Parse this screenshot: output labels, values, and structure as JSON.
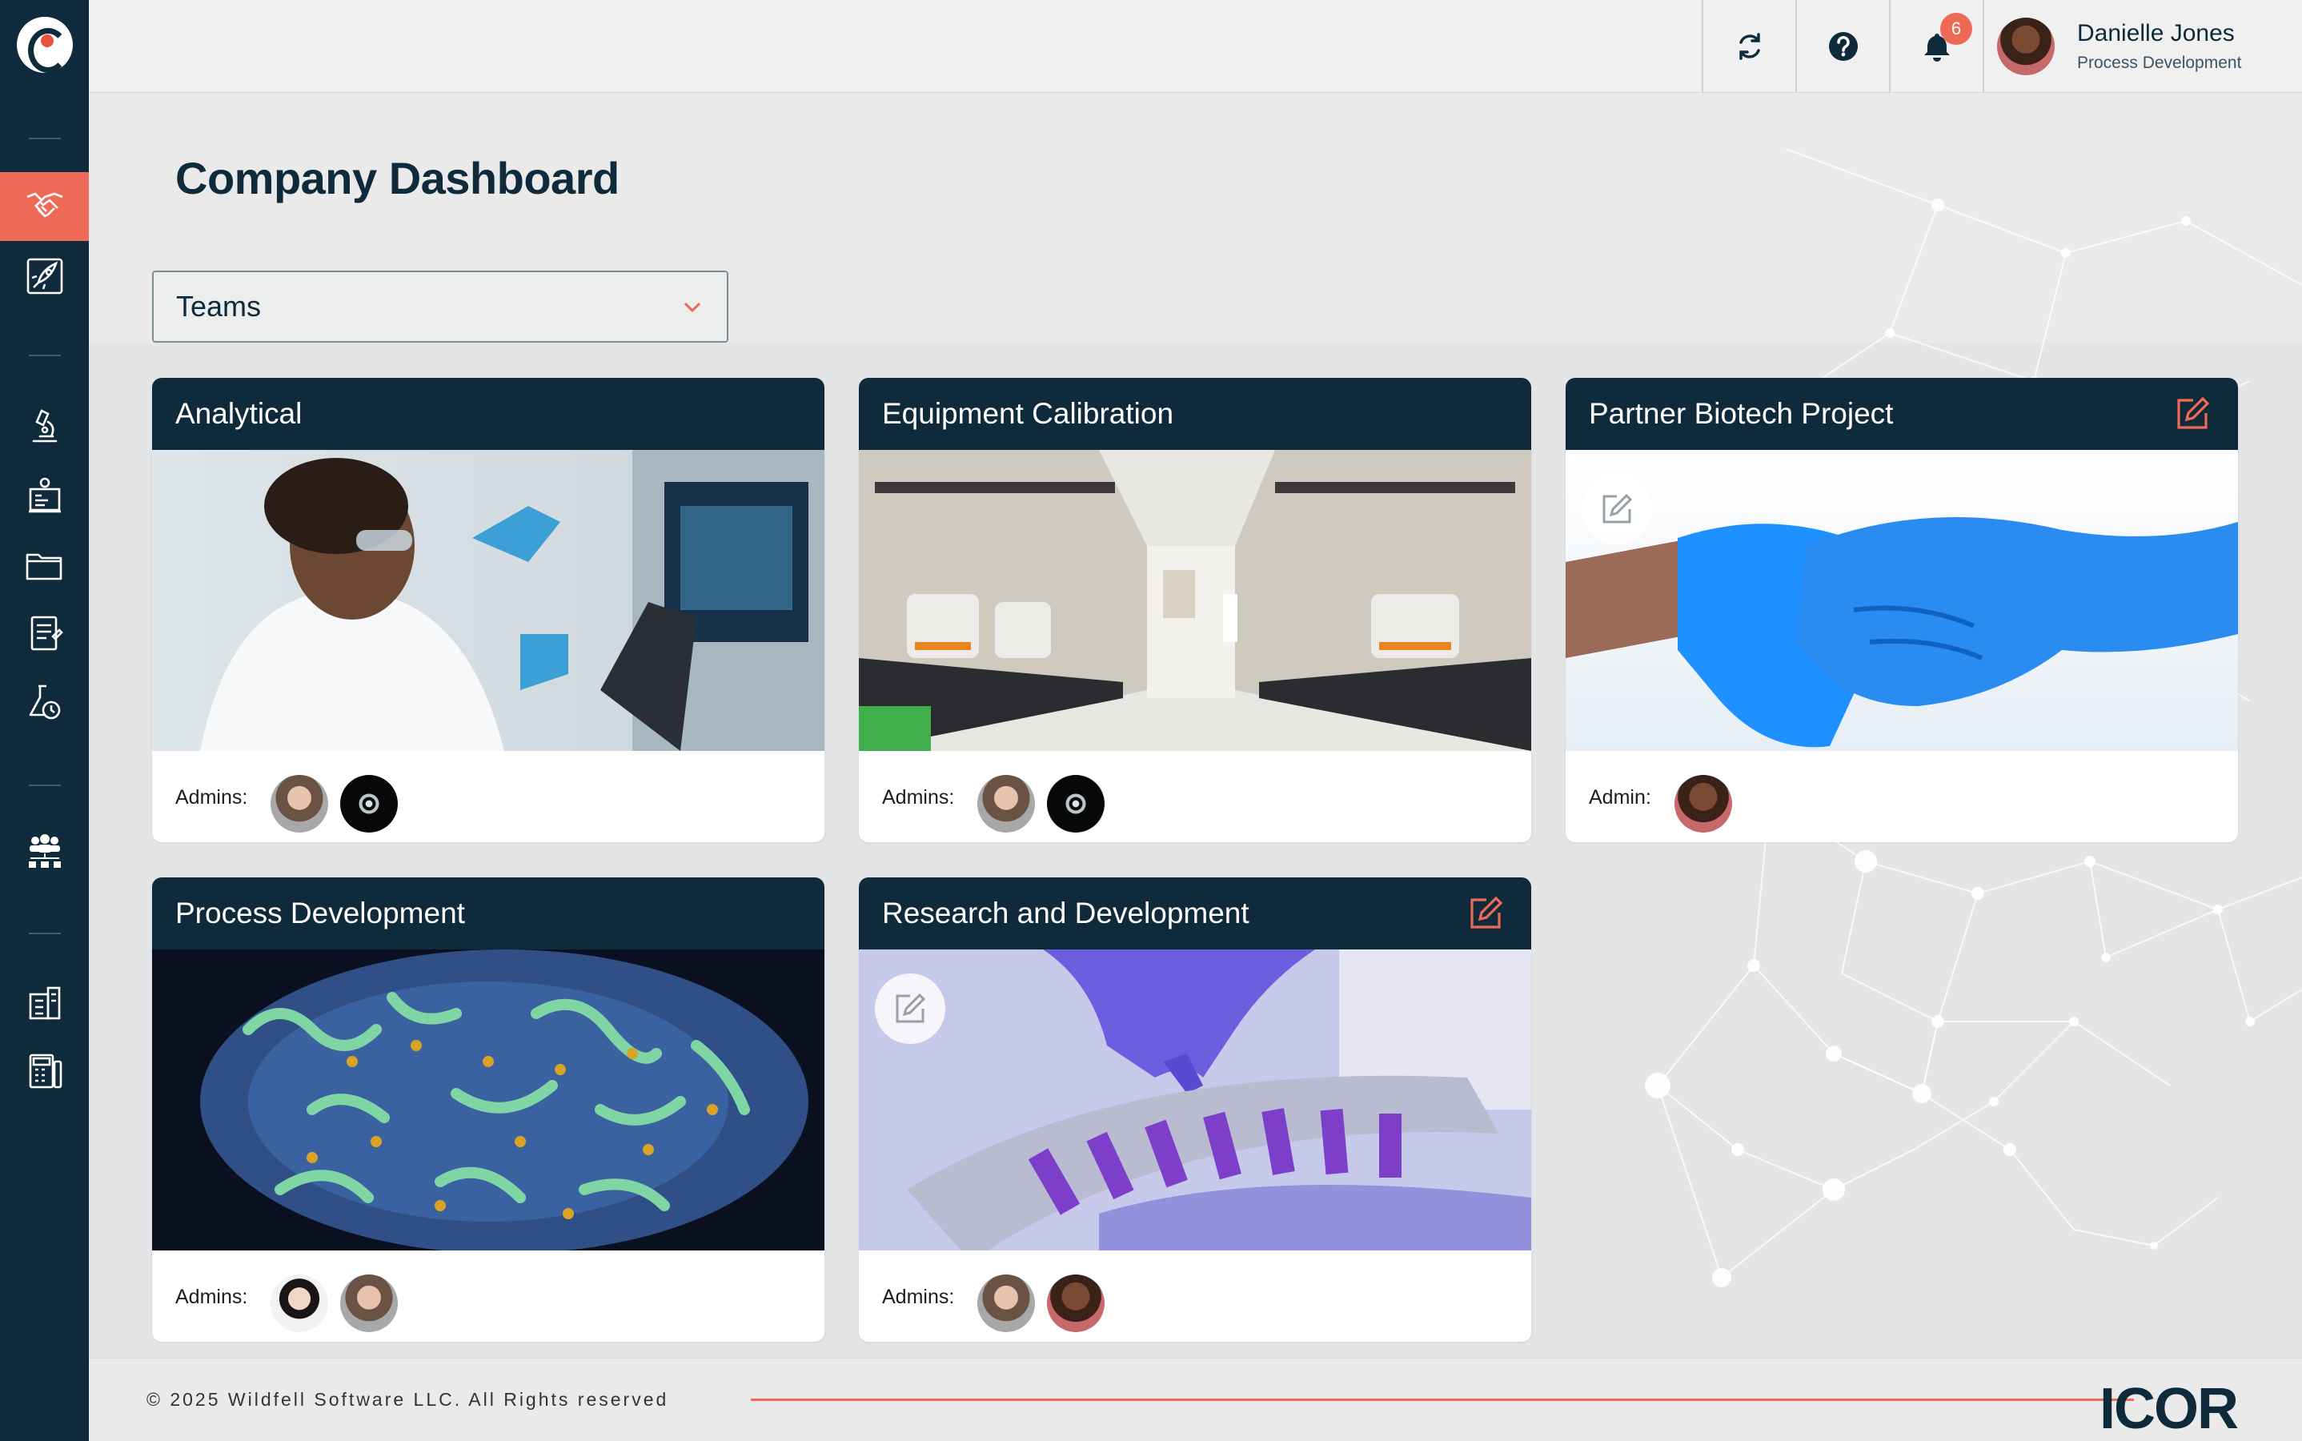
{
  "app": {
    "title": "Company Dashboard",
    "footer_logo": "ICOR"
  },
  "colors": {
    "navy": "#0f2a3b",
    "accent": "#ee6a57",
    "background": "#e4e5e7"
  },
  "topbar": {
    "sync_icon": "sync-icon",
    "help_icon": "help-icon",
    "notifications_icon": "bell-icon",
    "notifications_count": "6",
    "user": {
      "name": "Danielle Jones",
      "role": "Process Development"
    }
  },
  "sidebar": {
    "items": [
      {
        "icon": "handshake-icon",
        "active": true
      },
      {
        "icon": "rocket-icon",
        "active": false
      },
      {
        "icon": "microscope-icon",
        "active": false
      },
      {
        "icon": "lab-report-icon",
        "active": false
      },
      {
        "icon": "folder-icon",
        "active": false
      },
      {
        "icon": "notebook-icon",
        "active": false
      },
      {
        "icon": "flask-timer-icon",
        "active": false
      },
      {
        "icon": "team-org-icon",
        "active": false
      },
      {
        "icon": "building-icon",
        "active": false
      },
      {
        "icon": "calculator-icon",
        "active": false
      }
    ]
  },
  "filter": {
    "selected": "Teams"
  },
  "cards": [
    {
      "title": "Analytical",
      "admins_label": "Admins:",
      "editable": false
    },
    {
      "title": "Equipment Calibration",
      "admins_label": "Admins:",
      "editable": false
    },
    {
      "title": "Partner Biotech Project",
      "admins_label": "Admin:",
      "editable": true
    },
    {
      "title": "Process Development",
      "admins_label": "Admins:",
      "editable": false
    },
    {
      "title": "Research and Development",
      "admins_label": "Admins:",
      "editable": true
    }
  ],
  "footer": {
    "copyright": "© 2025 Wildfell Software LLC. All Rights reserved"
  }
}
